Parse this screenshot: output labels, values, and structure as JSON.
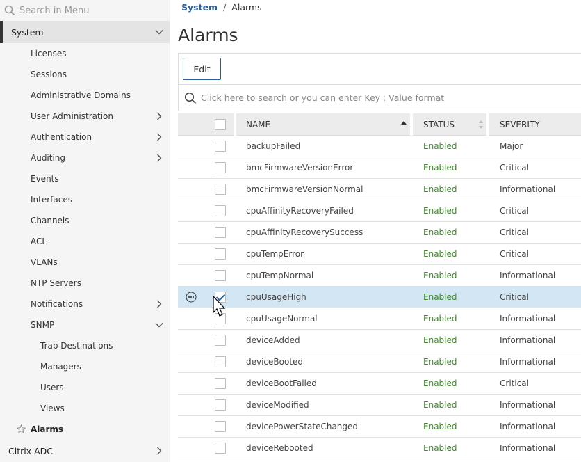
{
  "sidebar": {
    "search_placeholder": "Search in Menu",
    "section_system": "System",
    "items": [
      {
        "label": "Licenses"
      },
      {
        "label": "Sessions"
      },
      {
        "label": "Administrative Domains"
      },
      {
        "label": "User Administration"
      },
      {
        "label": "Authentication"
      },
      {
        "label": "Auditing"
      },
      {
        "label": "Events"
      },
      {
        "label": "Interfaces"
      },
      {
        "label": "Channels"
      },
      {
        "label": "ACL"
      },
      {
        "label": "VLANs"
      },
      {
        "label": "NTP Servers"
      },
      {
        "label": "Notifications"
      },
      {
        "label": "SNMP"
      }
    ],
    "snmp_items": [
      {
        "label": "Trap Destinations"
      },
      {
        "label": "Managers"
      },
      {
        "label": "Users"
      },
      {
        "label": "Views"
      }
    ],
    "active_item": "Alarms",
    "section_citrix": "Citrix ADC"
  },
  "breadcrumb": {
    "root": "System",
    "separator": "/",
    "current": "Alarms"
  },
  "page_title": "Alarms",
  "toolbar": {
    "edit_label": "Edit"
  },
  "search": {
    "placeholder": "Click here to search or you can enter Key : Value format"
  },
  "table": {
    "columns": {
      "name": "NAME",
      "status": "STATUS",
      "severity": "SEVERITY"
    },
    "rows": [
      {
        "name": "backupFailed",
        "status": "Enabled",
        "severity": "Major"
      },
      {
        "name": "bmcFirmwareVersionError",
        "status": "Enabled",
        "severity": "Critical"
      },
      {
        "name": "bmcFirmwareVersionNormal",
        "status": "Enabled",
        "severity": "Informational"
      },
      {
        "name": "cpuAffinityRecoveryFailed",
        "status": "Enabled",
        "severity": "Critical"
      },
      {
        "name": "cpuAffinityRecoverySuccess",
        "status": "Enabled",
        "severity": "Critical"
      },
      {
        "name": "cpuTempError",
        "status": "Enabled",
        "severity": "Critical"
      },
      {
        "name": "cpuTempNormal",
        "status": "Enabled",
        "severity": "Informational"
      },
      {
        "name": "cpuUsageHigh",
        "status": "Enabled",
        "severity": "Critical"
      },
      {
        "name": "cpuUsageNormal",
        "status": "Enabled",
        "severity": "Informational"
      },
      {
        "name": "deviceAdded",
        "status": "Enabled",
        "severity": "Informational"
      },
      {
        "name": "deviceBooted",
        "status": "Enabled",
        "severity": "Informational"
      },
      {
        "name": "deviceBootFailed",
        "status": "Enabled",
        "severity": "Critical"
      },
      {
        "name": "deviceModified",
        "status": "Enabled",
        "severity": "Informational"
      },
      {
        "name": "devicePowerStateChanged",
        "status": "Enabled",
        "severity": "Informational"
      },
      {
        "name": "deviceRebooted",
        "status": "Enabled",
        "severity": "Informational"
      }
    ]
  },
  "colors": {
    "link": "#2a5f9e",
    "enabled": "#3f8a2c",
    "selected_row": "#d3e6f3"
  }
}
